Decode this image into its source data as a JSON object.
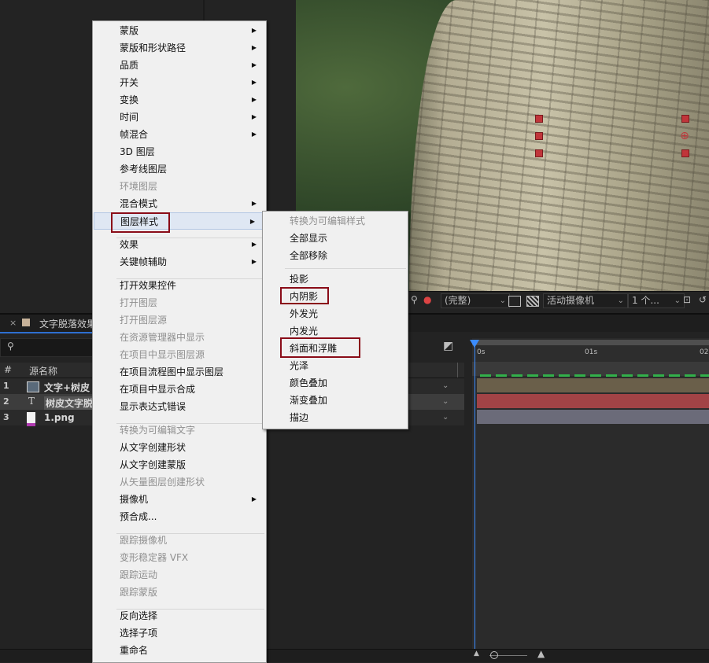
{
  "viewer_toolbar": {
    "resolution": "(完整)",
    "camera": "活动摄像机",
    "views": "1 个..."
  },
  "timeline": {
    "tab_label": "文字脱落效果",
    "column_name": "源名称",
    "column_hash": "#",
    "ruler_start": "0s",
    "ruler_mid": "01s",
    "ruler_end": "02",
    "layers": [
      {
        "num": "1",
        "name": "文字+树皮",
        "type_icon": "composition-icon"
      },
      {
        "num": "2",
        "name": "树皮文字脱",
        "type_icon": "text-layer-icon",
        "type_glyph": "T"
      },
      {
        "num": "3",
        "name": "1.png",
        "type_icon": "png-file-icon"
      }
    ]
  },
  "context_menu": {
    "items": [
      {
        "label": "蒙版",
        "submenu": true,
        "disabled": false
      },
      {
        "label": "蒙版和形状路径",
        "submenu": true,
        "disabled": false
      },
      {
        "label": "品质",
        "submenu": true,
        "disabled": false
      },
      {
        "label": "开关",
        "submenu": true,
        "disabled": false
      },
      {
        "label": "变换",
        "submenu": true,
        "disabled": false
      },
      {
        "label": "时间",
        "submenu": true,
        "disabled": false
      },
      {
        "label": "帧混合",
        "submenu": true,
        "disabled": false
      },
      {
        "label": "3D 图层",
        "submenu": false,
        "disabled": false
      },
      {
        "label": "参考线图层",
        "submenu": false,
        "disabled": false
      },
      {
        "label": "环境图层",
        "submenu": false,
        "disabled": true
      },
      {
        "label": "混合模式",
        "submenu": true,
        "disabled": false
      },
      {
        "label": "图层样式",
        "submenu": true,
        "disabled": false
      },
      {
        "label": "效果",
        "submenu": true,
        "disabled": false
      },
      {
        "label": "关键帧辅助",
        "submenu": true,
        "disabled": false
      },
      {
        "label": "打开效果控件",
        "submenu": false,
        "disabled": false
      },
      {
        "label": "打开图层",
        "submenu": false,
        "disabled": true
      },
      {
        "label": "打开图层源",
        "submenu": false,
        "disabled": true
      },
      {
        "label": "在资源管理器中显示",
        "submenu": false,
        "disabled": true
      },
      {
        "label": "在项目中显示图层源",
        "submenu": false,
        "disabled": true
      },
      {
        "label": "在项目流程图中显示图层",
        "submenu": false,
        "disabled": false
      },
      {
        "label": "在项目中显示合成",
        "submenu": false,
        "disabled": false
      },
      {
        "label": "显示表达式错误",
        "submenu": false,
        "disabled": false
      },
      {
        "label": "转换为可编辑文字",
        "submenu": false,
        "disabled": true
      },
      {
        "label": "从文字创建形状",
        "submenu": false,
        "disabled": false
      },
      {
        "label": "从文字创建蒙版",
        "submenu": false,
        "disabled": false
      },
      {
        "label": "从矢量图层创建形状",
        "submenu": false,
        "disabled": true
      },
      {
        "label": "摄像机",
        "submenu": true,
        "disabled": false
      },
      {
        "label": "预合成...",
        "submenu": false,
        "disabled": false
      },
      {
        "label": "跟踪摄像机",
        "submenu": false,
        "disabled": true
      },
      {
        "label": "变形稳定器 VFX",
        "submenu": false,
        "disabled": true
      },
      {
        "label": "跟踪运动",
        "submenu": false,
        "disabled": true
      },
      {
        "label": "跟踪蒙版",
        "submenu": false,
        "disabled": true
      },
      {
        "label": "反向选择",
        "submenu": false,
        "disabled": false
      },
      {
        "label": "选择子项",
        "submenu": false,
        "disabled": false
      },
      {
        "label": "重命名",
        "submenu": false,
        "disabled": false
      }
    ]
  },
  "submenu": {
    "items": [
      {
        "label": "转换为可编辑样式",
        "disabled": true
      },
      {
        "label": "全部显示",
        "disabled": false
      },
      {
        "label": "全部移除",
        "disabled": false
      },
      {
        "label": "投影",
        "disabled": false
      },
      {
        "label": "内阴影",
        "disabled": false
      },
      {
        "label": "外发光",
        "disabled": false
      },
      {
        "label": "内发光",
        "disabled": false
      },
      {
        "label": "斜面和浮雕",
        "disabled": false
      },
      {
        "label": "光泽",
        "disabled": false
      },
      {
        "label": "颜色叠加",
        "disabled": false
      },
      {
        "label": "渐变叠加",
        "disabled": false
      },
      {
        "label": "描边",
        "disabled": false
      }
    ]
  },
  "colors": {
    "menu_bg": "#f0f0f0",
    "highlight_box": "#8a0c18",
    "playhead": "#3b8cff",
    "layer2_bar": "#a24346"
  }
}
